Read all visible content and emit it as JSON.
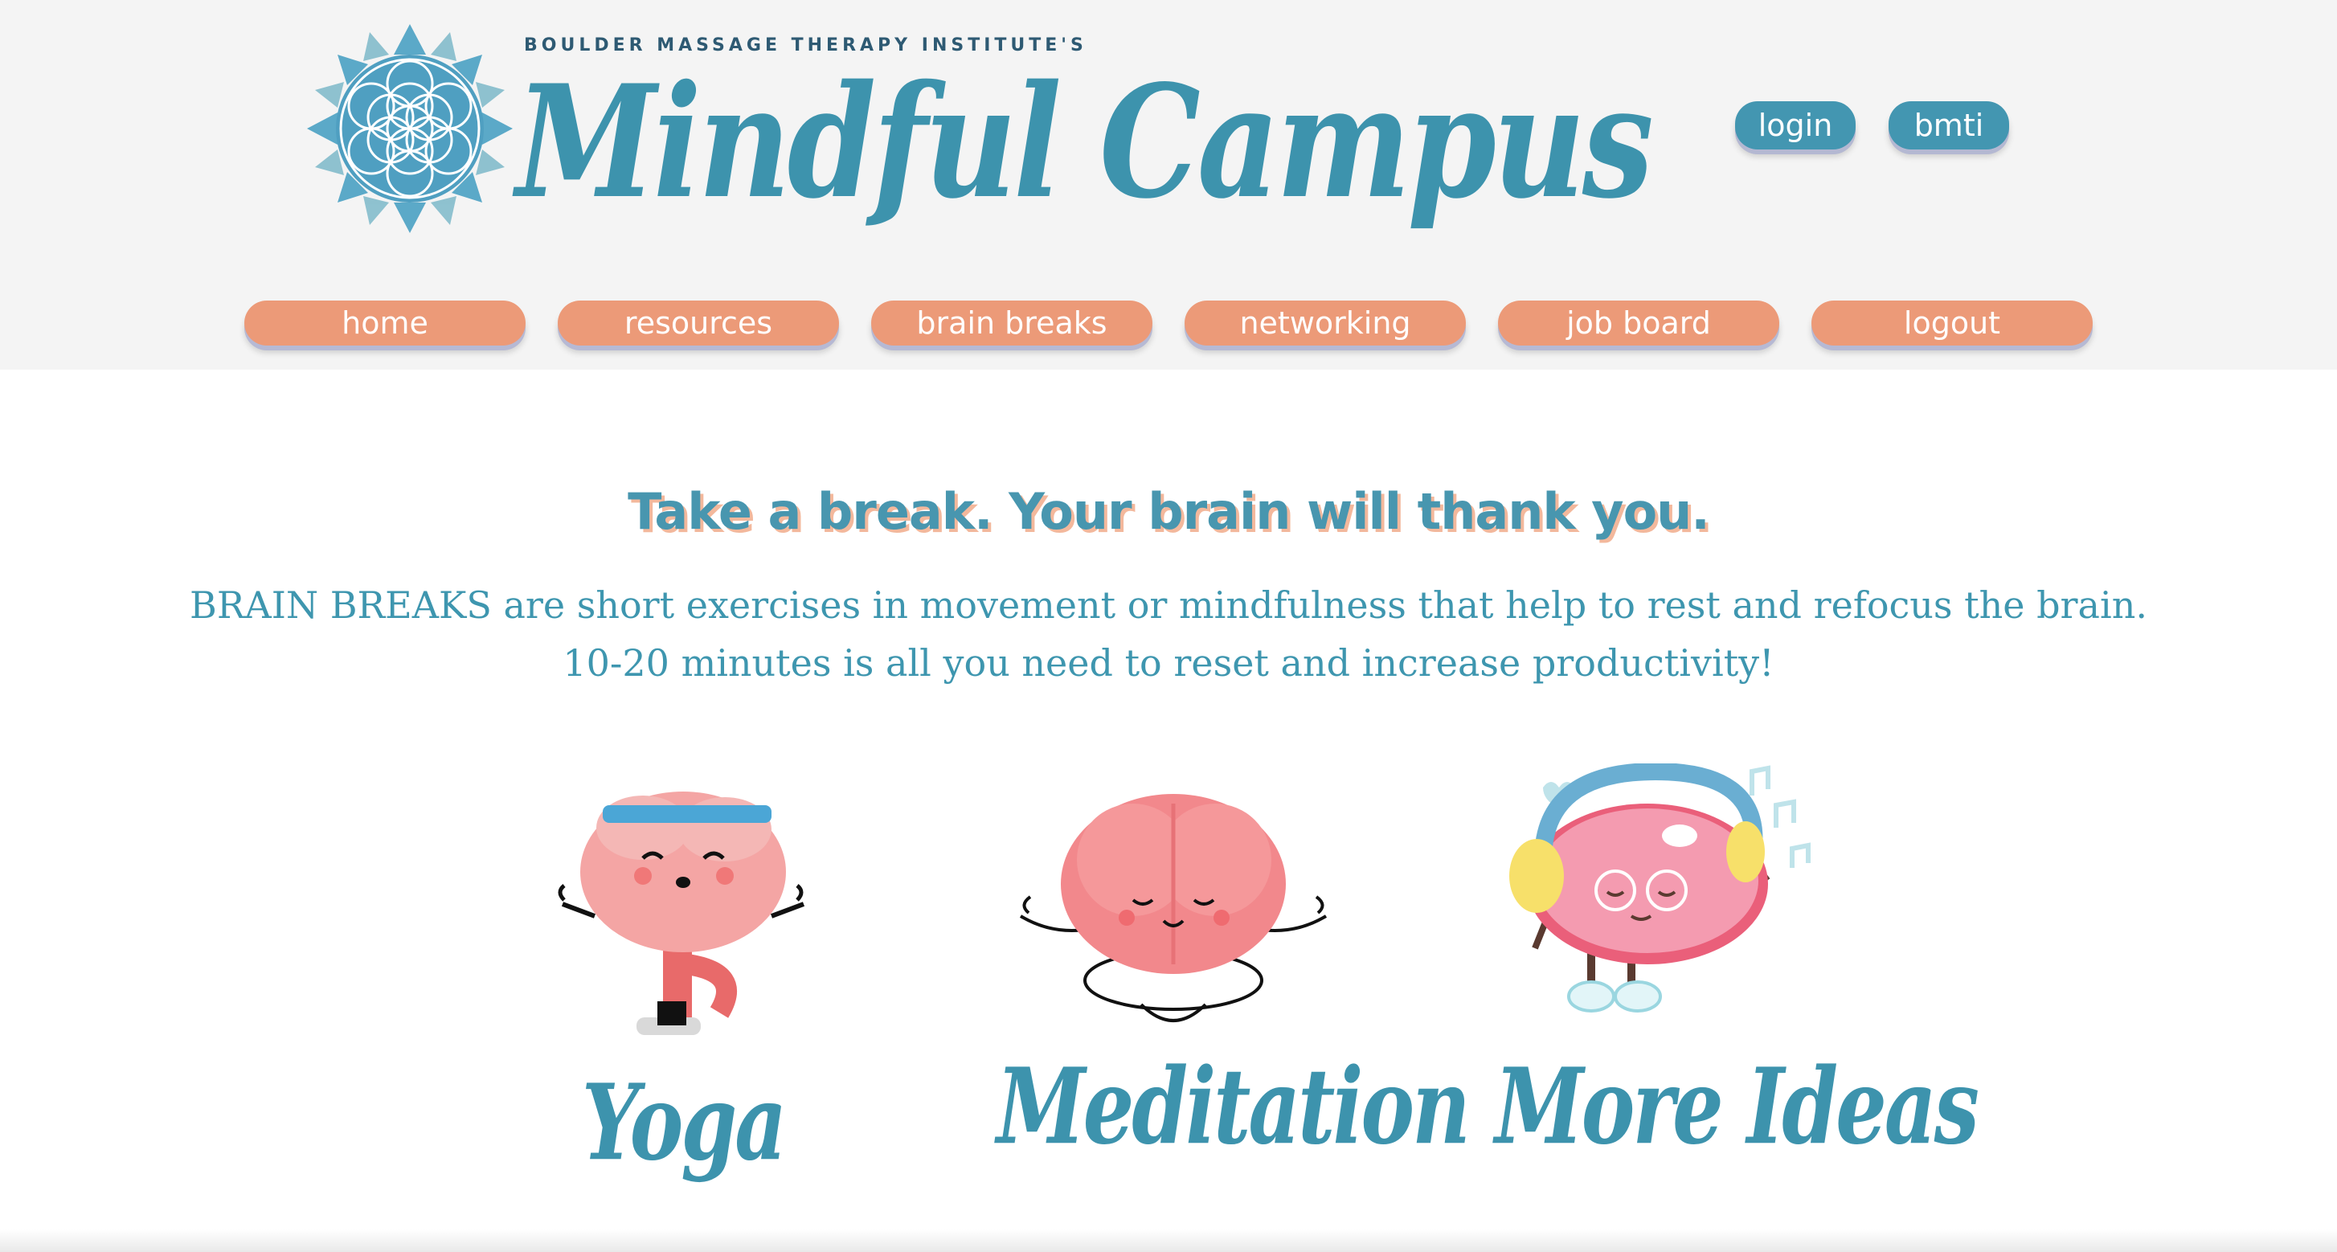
{
  "header": {
    "logo": {
      "supertitle": "BOULDER MASSAGE THERAPY INSTITUTE'S",
      "title": "Mindful Campus"
    },
    "account_buttons": [
      "login",
      "bmti"
    ],
    "nav": [
      "home",
      "resources",
      "brain breaks",
      "networking",
      "job board",
      "logout"
    ]
  },
  "main": {
    "headline": "Take a break. Your brain will thank you.",
    "intro_lines": [
      "BRAIN BREAKS are short exercises in movement or mindfulness that help to rest and refocus the brain.",
      "10-20 minutes is all you need to reset and increase productivity!"
    ],
    "cards": [
      {
        "label": "Yoga",
        "icon": "yoga-brain-icon"
      },
      {
        "label": "Meditation",
        "icon": "meditation-brain-icon"
      },
      {
        "label": "More Ideas",
        "icon": "music-brain-icon"
      }
    ]
  },
  "colors": {
    "teal": "#4396b1",
    "coral": "#ec9a78",
    "header_bg": "#f4f4f4",
    "brain_pink": "#f2888c"
  }
}
